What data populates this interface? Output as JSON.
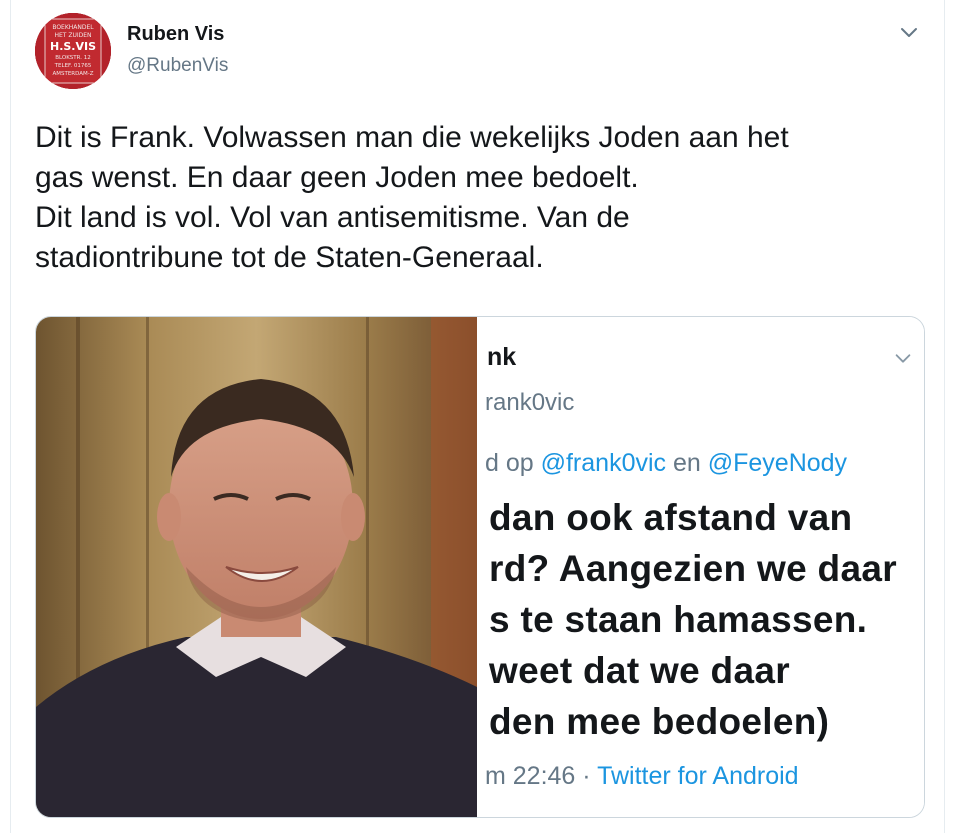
{
  "author": {
    "name": "Ruben Vis",
    "handle": "@RubenVis",
    "avatar_text": [
      "BOEKHANDEL",
      "HET ZUIDEN",
      "H.S.VIS",
      "BLOKSTR. 12",
      "TELEF. 01765",
      "AMSTERDAM-Z"
    ]
  },
  "tweet": {
    "lines": [
      "Dit is Frank. Volwassen man die wekelijks Joden aan het",
      "gas wenst. En daar geen Joden mee bedoelt.",
      "Dit land is vol. Vol van antisemitisme. Van de",
      "stadiontribune tot de Staten-Generaal."
    ]
  },
  "embedded_screenshot": {
    "name": "nk",
    "handle": "rank0vic",
    "reply_prefix": "d op ",
    "reply_mention_1": "@frank0vic",
    "reply_joiner": " en ",
    "reply_mention_2": "@FeyeNody",
    "body_lines": [
      " dan ook afstand van",
      "rd? Aangezien we daar",
      "s te staan hamassen.",
      " weet dat we daar",
      "den mee bedoelen)"
    ],
    "meta_time": "m 22:46 · ",
    "meta_source": "Twitter for Android"
  },
  "colors": {
    "text": "#14171a",
    "secondary": "#657786",
    "link": "#1b95e0",
    "border": "#e6ecf0"
  },
  "icons": {
    "caret": "chevron-down-icon"
  }
}
